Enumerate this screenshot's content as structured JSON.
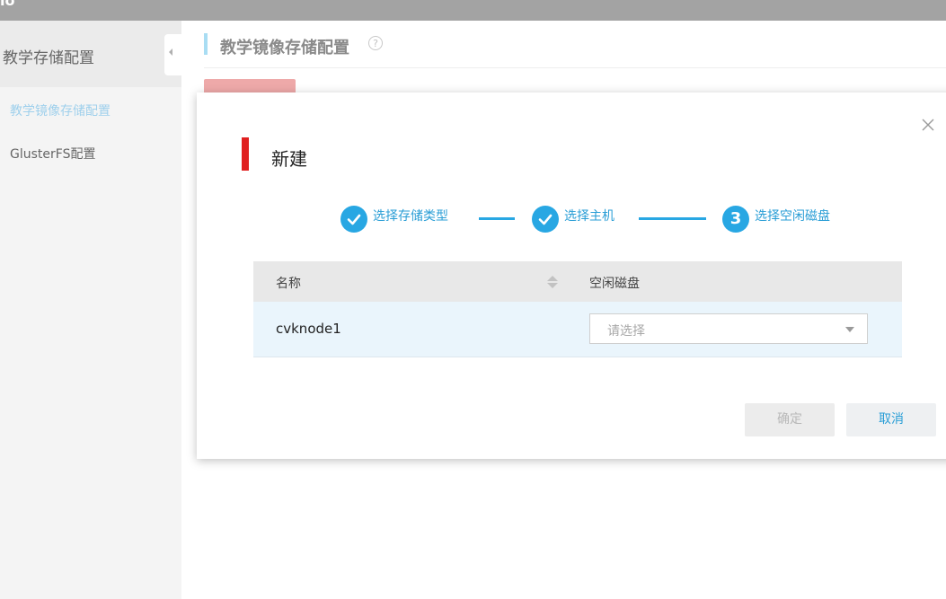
{
  "topbar": {
    "logo_fragment": "lo"
  },
  "sidebar": {
    "title": "教学存储配置",
    "items": [
      {
        "label": "教学镜像存储配置",
        "active": true
      },
      {
        "label": "GlusterFS配置",
        "active": false
      }
    ]
  },
  "main": {
    "title": "教学镜像存储配置",
    "help_icon_glyph": "?"
  },
  "modal": {
    "title": "新建",
    "steps": [
      {
        "label": "选择存储类型",
        "state": "done"
      },
      {
        "label": "选择主机",
        "state": "done"
      },
      {
        "label": "选择空闲磁盘",
        "state": "current",
        "number": "3"
      }
    ],
    "table": {
      "columns": [
        "名称",
        "空闲磁盘"
      ],
      "rows": [
        {
          "name": "cvknode1",
          "disk_placeholder": "请选择"
        }
      ]
    },
    "buttons": {
      "confirm": "确定",
      "cancel": "取消"
    }
  },
  "colors": {
    "accent": "#28a7e3",
    "title_bar": "#e02020",
    "topbar": "#a3a3a3"
  }
}
